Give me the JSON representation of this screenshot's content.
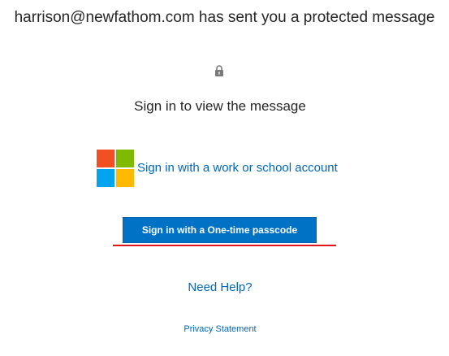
{
  "header": {
    "message": "harrison@newfathom.com has sent you a protected message"
  },
  "icons": {
    "lock": "lock-icon",
    "microsoft_logo": "microsoft-logo-icon"
  },
  "main": {
    "title": "Sign in to view the message",
    "work_account_link": "Sign in with a work or school account",
    "otp_button": "Sign in with a One-time passcode",
    "help_link": "Need Help?",
    "privacy_link": "Privacy Statement"
  },
  "colors": {
    "link": "#0067b8",
    "button_bg": "#0072c6",
    "underline": "#e0161c",
    "ms_red": "#f25022",
    "ms_green": "#7fba00",
    "ms_blue": "#00a4ef",
    "ms_yellow": "#ffb900"
  }
}
